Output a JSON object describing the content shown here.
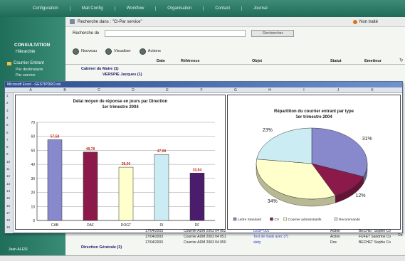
{
  "topnav": [
    "Configuration",
    "Mail Config",
    "Workflow",
    "Organisation",
    "Contact",
    "Journal"
  ],
  "sidebar": {
    "title": "CONSULTATION",
    "subtitle": "Hiérarchie",
    "section": "Courrier Entrant",
    "links": [
      "Par destinataire",
      "Par service"
    ],
    "footer": "Jean-ALESI"
  },
  "search": {
    "scope_label": "Recherche dans : \"Cl-Par service\"",
    "non_traite": "Non traité",
    "field_label": "Recherche de",
    "input_value": "",
    "button": "Rechercher"
  },
  "toolbar": [
    "Nouveau",
    "Visualiser",
    "Actions"
  ],
  "table_header": [
    "Date",
    "Référence",
    "Objet",
    "Statut",
    "Emetteur"
  ],
  "groups": {
    "cabinet": "Cabinet du Maire (1)",
    "verspie": "VERSPIE Jacques (1)",
    "direction": "Direction Générale (3)"
  },
  "excel": {
    "title": "Microsoft Excel - GESTIPDRO.xls",
    "columns": [
      "A",
      "B",
      "C",
      "D",
      "E",
      "F",
      "G",
      "H",
      "I",
      "J",
      "K"
    ],
    "rows": [
      "1",
      "2",
      "3",
      "4",
      "5",
      "6",
      "7",
      "8",
      "9",
      "10",
      "11",
      "12",
      "13",
      "14",
      "15",
      "16",
      "17",
      "18",
      "19"
    ]
  },
  "chart_data": [
    {
      "type": "bar",
      "title": "Délai moyen de réponse en jours par Direction",
      "subtitle": "1er trimestre 2004",
      "categories": [
        "CAB",
        "DAF",
        "DOGT",
        "DI",
        "DF"
      ],
      "values": [
        57.58,
        48.78,
        38.0,
        47.08,
        33.84
      ],
      "value_labels": [
        "57,58",
        "48,78",
        "38,00",
        "47,08",
        "33,84"
      ],
      "colors": [
        "#8888cc",
        "#8b1a4a",
        "#ffffcc",
        "#ccecf4",
        "#4b1c6b"
      ],
      "ylim": [
        0,
        70
      ],
      "yticks": [
        0,
        10,
        20,
        30,
        40,
        50,
        60,
        70
      ],
      "grid": true
    },
    {
      "type": "pie",
      "title": "Répartition du courrier entrant par type",
      "subtitle": "1er trimestre 2004",
      "slices": [
        {
          "name": "Lettre Standard",
          "value": 31,
          "label": "31%",
          "color": "#8888cc"
        },
        {
          "name": "CV",
          "value": 12,
          "label": "12%",
          "color": "#8b1a4a"
        },
        {
          "name": "Courrier administratifs",
          "value": 34,
          "label": "34%",
          "color": "#ffffcc"
        },
        {
          "name": "Recommandé",
          "value": 23,
          "label": "23%",
          "color": "#ccecf4"
        }
      ],
      "legend": "bottom"
    }
  ],
  "list_rows": [
    {
      "date": "17/04/2003",
      "ref": "Courrier ADM 2003 04 052",
      "objet": "LESP 001",
      "statut": "Action",
      "emetteur": "BECHET Sophie Co"
    },
    {
      "date": "17/04/2003",
      "ref": "Courrier ADM 2003 04 051",
      "objet": "Test de mails avec (?)",
      "statut": "Action",
      "emetteur": "FUFET Sandrine Co"
    },
    {
      "date": "17/04/2003",
      "ref": "Courrier ADM 2003 04 050",
      "objet": "alety",
      "statut": "Dos",
      "emetteur": "BECHET Sophie Co"
    }
  ],
  "right_fragments": [
    "Ty",
    "Co",
    "Co",
    "Co",
    "Co",
    "Co",
    "Co",
    "Co",
    "Co",
    "Co",
    "Co",
    "Co",
    "Co",
    "Co",
    "Co",
    "Co"
  ]
}
